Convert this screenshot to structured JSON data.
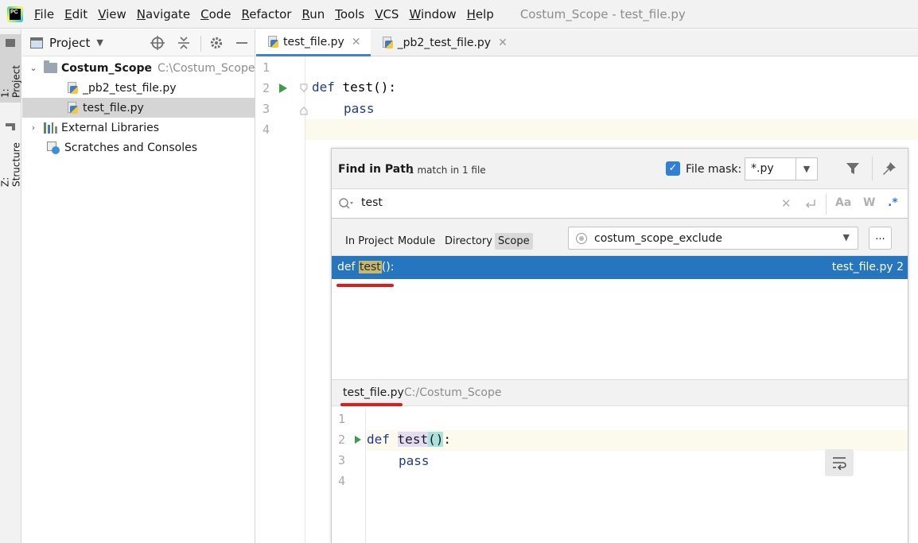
{
  "menubar": {
    "items": [
      "File",
      "Edit",
      "View",
      "Navigate",
      "Code",
      "Refactor",
      "Run",
      "Tools",
      "VCS",
      "Window",
      "Help"
    ],
    "window_title": "Costum_Scope - test_file.py",
    "logo_text": "PC"
  },
  "left_strip": {
    "project_tab": "1: Project",
    "structure_tab": "Z: Structure"
  },
  "project_panel": {
    "title": "Project",
    "tree": {
      "root_name": "Costum_Scope",
      "root_path": "C:\\Costum_Scope",
      "file1": "_pb2_test_file.py",
      "file2": "test_file.py",
      "libraries": "External Libraries",
      "scratches": "Scratches and Consoles"
    }
  },
  "editor_tabs": [
    {
      "label": "test_file.py",
      "active": true
    },
    {
      "label": "_pb2_test_file.py",
      "active": false
    }
  ],
  "editor": {
    "line_numbers": [
      "1",
      "2",
      "3",
      "4"
    ],
    "line2_kw": "def",
    "line2_rest": " test():",
    "line3": "pass"
  },
  "find_dialog": {
    "title": "Find in Path",
    "match_count": "1 match in 1 file",
    "file_mask_label": "File mask:",
    "file_mask_checked": true,
    "file_mask_value": "*.py",
    "search_value": "test",
    "search_options": {
      "case": "Aa",
      "words": "W",
      "regex": ".*"
    },
    "scope_tabs": [
      "In Project",
      "Module",
      "Directory",
      "Scope"
    ],
    "active_scope_tab": "Scope",
    "scope_value": "costum_scope_exclude",
    "scope_more": "...",
    "result": {
      "prefix": "def ",
      "match": "test",
      "suffix": "():",
      "file": "test_file.py 2"
    },
    "preview": {
      "file": "test_file.py",
      "path": "C:/Costum_Scope",
      "line_numbers": [
        "1",
        "2",
        "3",
        "4"
      ],
      "kw": "def",
      "fn": "test",
      "paren": "()",
      "colon": ":",
      "line3": "pass"
    }
  },
  "colors": {
    "selection": "#2675bf",
    "annotation_underline": "#e01b1b",
    "keyword": "#1f3b8f",
    "run_arrow": "#3f9b4a"
  }
}
